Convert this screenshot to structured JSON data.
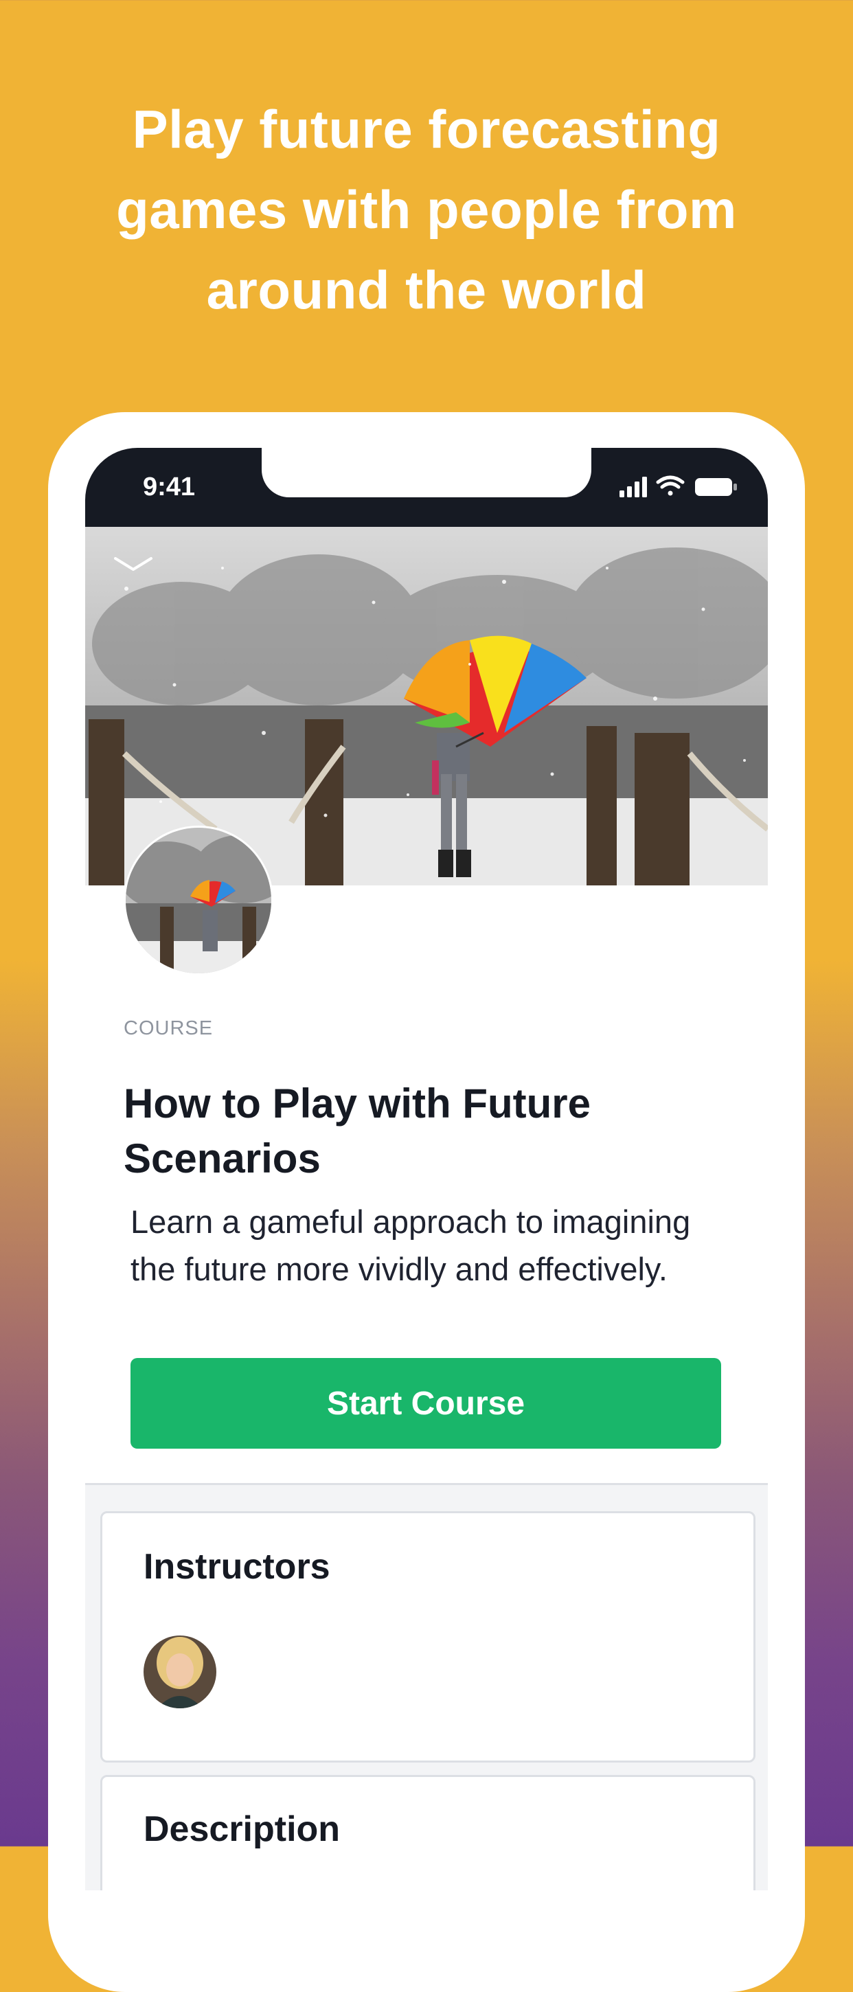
{
  "headline": {
    "line1": "Play future forecasting",
    "line2": "games with people from",
    "line3": "around the world"
  },
  "status_bar": {
    "time": "9:41",
    "icons": [
      "cellular-signal-icon",
      "wifi-icon",
      "battery-icon"
    ]
  },
  "hero": {
    "collapse_icon": "chevron-down-icon"
  },
  "course": {
    "eyebrow": "COURSE",
    "title": "How to Play with Future Scenarios",
    "description": "Learn a gameful approach to imagining the future more vividly and effectively.",
    "start_button": "Start Course"
  },
  "instructors_card": {
    "title": "Instructors"
  },
  "description_card": {
    "title": "Description"
  },
  "colors": {
    "background_top": "#F0B335",
    "background_bottom": "#6A3A8E",
    "status_bar": "#161A23",
    "primary_button": "#19B66A",
    "text_dark": "#161A23",
    "eyebrow_gray": "#8E949E"
  }
}
